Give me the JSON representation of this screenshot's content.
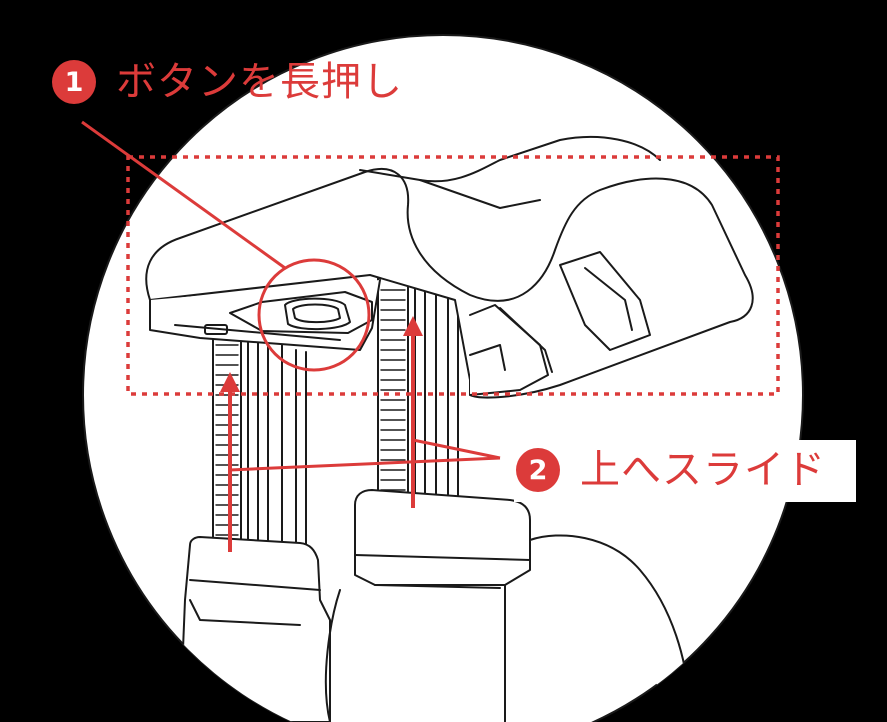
{
  "colors": {
    "accent": "#dc3b3a",
    "background": "#000000",
    "lens_fill": "#ffffff",
    "line_art": "#1a1a1a"
  },
  "icons": [
    "circular-magnifier",
    "dashed-highlight-box",
    "up-arrow-icon",
    "button-highlight-circle"
  ],
  "callouts": [
    {
      "number": "1",
      "text": "ボタンを長押し"
    },
    {
      "number": "2",
      "text": "上へスライド"
    }
  ]
}
